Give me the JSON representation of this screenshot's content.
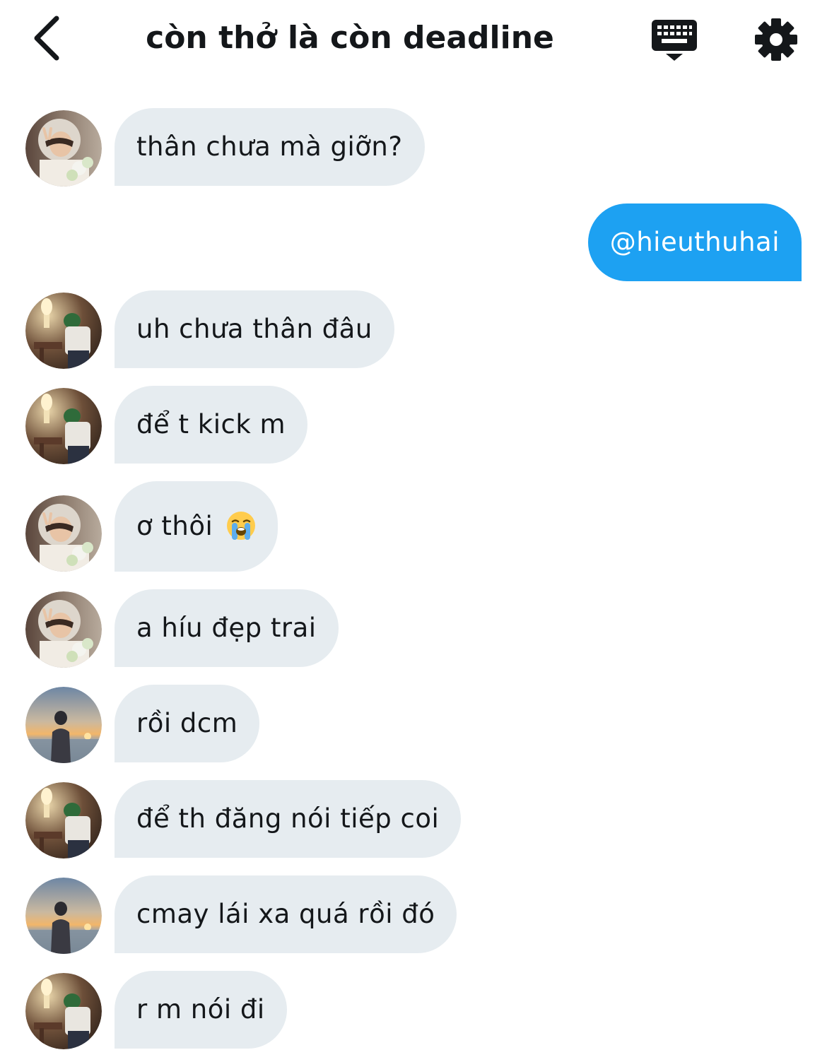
{
  "header": {
    "title": "còn thở là còn deadline",
    "back_icon": "chevron-left-icon",
    "keyboard_icon": "keyboard-icon",
    "settings_icon": "gear-icon"
  },
  "colors": {
    "incoming_bubble": "#e6ecf0",
    "outgoing_bubble": "#1da1f2",
    "text": "#14171a"
  },
  "messages": [
    {
      "direction": "in",
      "sender_avatar": "hooded-avatar",
      "text": "thân chưa mà giỡn?"
    },
    {
      "direction": "out",
      "text": "@hieuthuhai"
    },
    {
      "direction": "in",
      "sender_avatar": "room-avatar",
      "text": "uh chưa thân đâu"
    },
    {
      "direction": "in",
      "sender_avatar": "room-avatar",
      "text": "để t kick m"
    },
    {
      "direction": "in",
      "sender_avatar": "hooded-avatar",
      "text": "ơ thôi",
      "emoji": "loudly-crying-face-icon"
    },
    {
      "direction": "in",
      "sender_avatar": "hooded-avatar",
      "text": "a híu đẹp trai"
    },
    {
      "direction": "in",
      "sender_avatar": "sunset-avatar",
      "text": "rồi dcm"
    },
    {
      "direction": "in",
      "sender_avatar": "room-avatar",
      "text": "để th đăng nói tiếp coi"
    },
    {
      "direction": "in",
      "sender_avatar": "sunset-avatar",
      "text": "cmay lái xa quá rồi đó"
    },
    {
      "direction": "in",
      "sender_avatar": "room-avatar",
      "text": "r m nói đi"
    }
  ]
}
